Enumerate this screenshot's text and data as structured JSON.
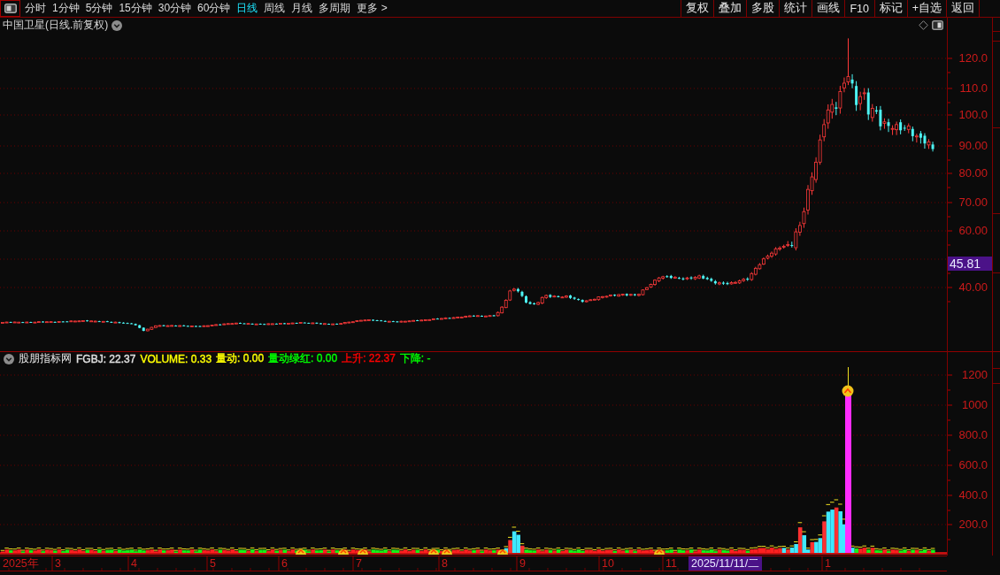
{
  "toolbar": {
    "periods": [
      {
        "label": "分时",
        "selected": false
      },
      {
        "label": "1分钟",
        "selected": false
      },
      {
        "label": "5分钟",
        "selected": false
      },
      {
        "label": "15分钟",
        "selected": false
      },
      {
        "label": "30分钟",
        "selected": false
      },
      {
        "label": "60分钟",
        "selected": false
      },
      {
        "label": "日线",
        "selected": true
      },
      {
        "label": "周线",
        "selected": false
      },
      {
        "label": "月线",
        "selected": false
      },
      {
        "label": "多周期",
        "selected": false
      },
      {
        "label": "更多 >",
        "selected": false
      }
    ],
    "actions": [
      "复权",
      "叠加",
      "多股",
      "统计",
      "画线",
      "F10",
      "标记",
      "+自选",
      "返回"
    ]
  },
  "price_panel": {
    "title": "中国卫星(日线.前复权)",
    "axis_labels": [
      "120.0",
      "110.0",
      "100.0",
      "90.00",
      "80.00",
      "70.00",
      "60.00",
      "40.00"
    ],
    "current_price": "45.81"
  },
  "indicator_panel": {
    "name": "股朋指标网",
    "readings": [
      {
        "text": "FGBJ: 22.37",
        "color": "#e0e0e0"
      },
      {
        "text": "VOLUME: 0.33",
        "color": "#ffff00"
      },
      {
        "text": "量动: 0.00",
        "color": "#ffff00"
      },
      {
        "text": "量动绿红: 0.00",
        "color": "#00ff00"
      },
      {
        "text": "上升: 22.37",
        "color": "#ff0000"
      },
      {
        "text": "下降: -",
        "color": "#00ff00"
      }
    ],
    "axis_labels": [
      "1200",
      "1000",
      "800.0",
      "600.0",
      "400.0",
      "200.0"
    ]
  },
  "date_axis": {
    "labels": [
      "2025年",
      "3",
      "4",
      "5",
      "6",
      "7",
      "8",
      "9",
      "10",
      "11",
      "1"
    ],
    "cursor_date": "2025/11/11/二"
  }
}
